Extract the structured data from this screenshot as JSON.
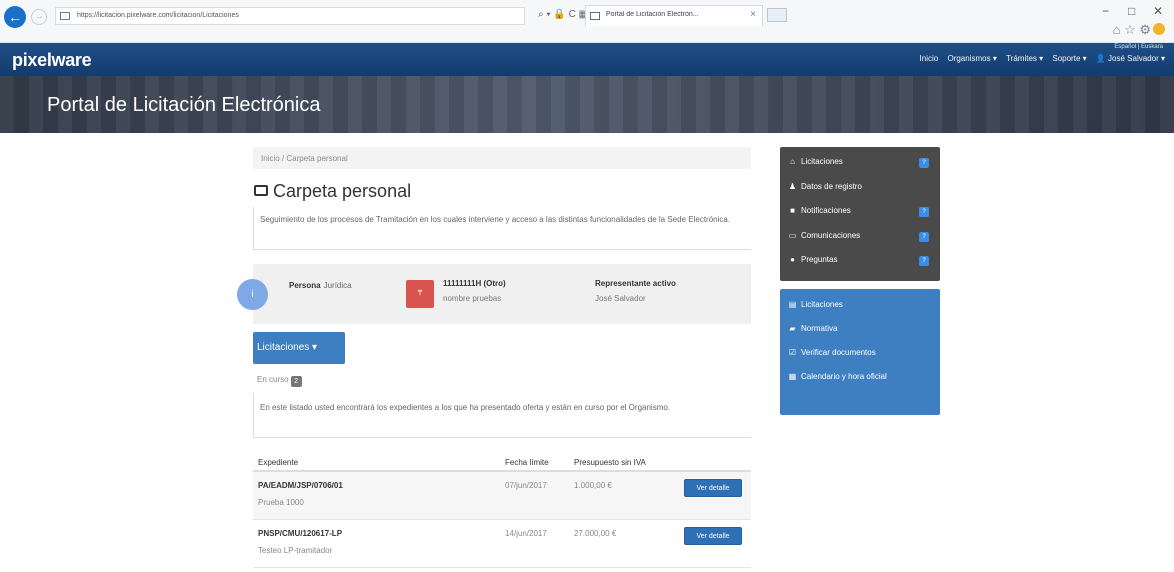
{
  "browser": {
    "url": "https://licitacion.pixelware.com/licitacion/Licitaciones",
    "tab_title": "Portal de Licitación Electrón...",
    "tab_close": "×",
    "back_glyph": "←",
    "forward_glyph": "→",
    "tools": "⌕ ▾ 🔒 C ▦",
    "minimize": "−",
    "maximize": "□",
    "close": "✕",
    "icons": "⌂ ☆ ⚙"
  },
  "site": {
    "brand": "pixelware",
    "lang": "Español | Euskara",
    "nav": [
      "Inicio",
      "Organismos ▾",
      "Trámites ▾",
      "Soporte ▾",
      "👤 José Salvador ▾"
    ],
    "banner_title": "Portal de Licitación Electrónica"
  },
  "breadcrumb": "Inicio  /  Carpeta personal",
  "page_title": "Carpeta personal",
  "intro": "Seguimiento de los procesos de Tramitación en los cuales interviene y acceso a las distintas funcionalidades de la Sede Electrónica.",
  "entity": {
    "circle": "i",
    "type_label": "Persona",
    "type_value": "Jurídica",
    "badge": "₸",
    "id": "11111111H (Otro)",
    "name": "nombre pruebas",
    "rep_label": "Representante activo",
    "rep_value": "José Salvador"
  },
  "licitaciones_dropdown": "Licitaciones ▾",
  "en_curso": {
    "label": "En curso",
    "count": "2"
  },
  "list_intro": "En este listado usted encontrará los expedientes a los que ha presentado oferta y están en curso por el Organismo.",
  "table": {
    "headers": [
      "Expediente",
      "Fecha límite",
      "Presupuesto sin IVA"
    ],
    "rows": [
      {
        "expediente": "PA/EADM/JSP/0706/01",
        "descripcion": "Prueba 1000",
        "fecha": "07/jun/2017",
        "presupuesto": "1.000,00 €",
        "boton": "Ver detalle"
      },
      {
        "expediente": "PNSP/CMU/120617-LP",
        "descripcion": "Testeo LP-tramitador",
        "fecha": "14/jun/2017",
        "presupuesto": "27.000,00 €",
        "boton": "Ver detalle"
      }
    ]
  },
  "sidebar_user": [
    {
      "icon": "⌂",
      "icon_name": "gavel-icon",
      "label": "Licitaciones",
      "badge": "?"
    },
    {
      "icon": "♟",
      "icon_name": "user-icon",
      "label": "Datos de registro",
      "badge": ""
    },
    {
      "icon": "■",
      "icon_name": "envelope-icon",
      "label": "Notificaciones",
      "badge": "?"
    },
    {
      "icon": "▭",
      "icon_name": "comment-icon",
      "label": "Comunicaciones",
      "badge": "?"
    },
    {
      "icon": "●",
      "icon_name": "question-icon",
      "label": "Preguntas",
      "badge": "?"
    }
  ],
  "sidebar_public": [
    {
      "icon": "▤",
      "icon_name": "list-icon",
      "label": "Licitaciones"
    },
    {
      "icon": "▰",
      "icon_name": "book-icon",
      "label": "Normativa"
    },
    {
      "icon": "☑",
      "icon_name": "check-icon",
      "label": "Verificar documentos"
    },
    {
      "icon": "▦",
      "icon_name": "calendar-icon",
      "label": "Calendario y hora oficial"
    }
  ]
}
